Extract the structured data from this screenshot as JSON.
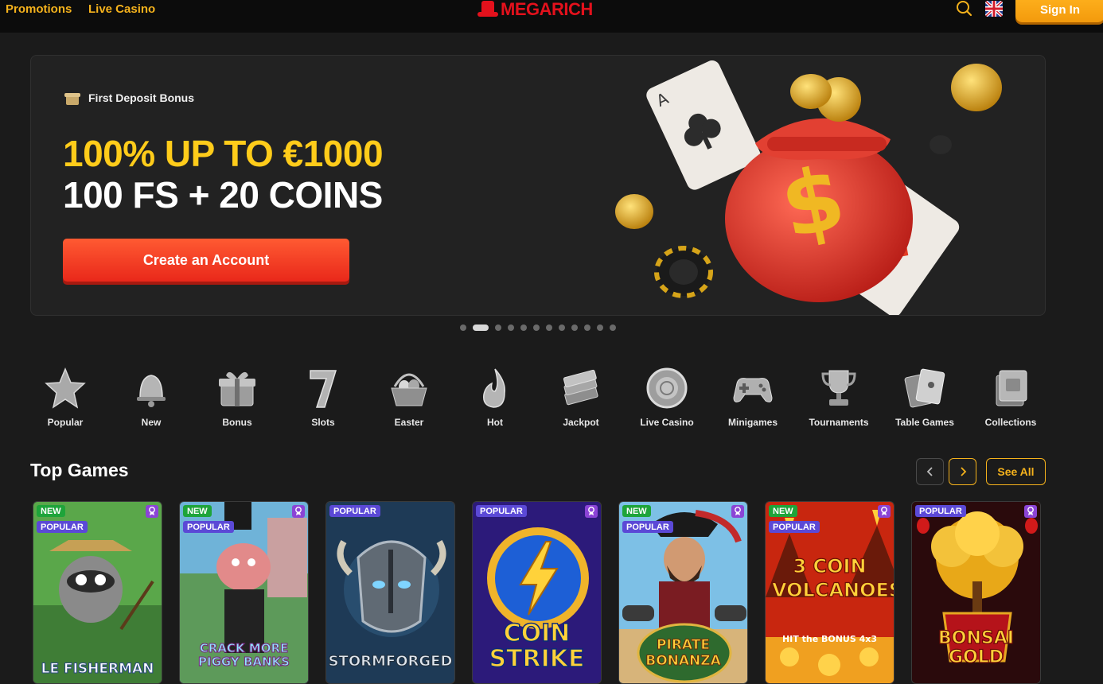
{
  "header": {
    "nav": [
      "Promotions",
      "Live Casino"
    ],
    "logo": "MEGARICH",
    "signin_label": "Sign In",
    "language": "English"
  },
  "hero": {
    "tag": "First Deposit Bonus",
    "headline_line1": "100% UP TO €1000",
    "headline_line2": "100 FS + 20 COINS",
    "cta_label": "Create an Account",
    "slides_total": 12,
    "active_slide": 2
  },
  "categories": [
    {
      "label": "Popular",
      "icon": "star-icon"
    },
    {
      "label": "New",
      "icon": "bell-icon"
    },
    {
      "label": "Bonus",
      "icon": "gift-icon"
    },
    {
      "label": "Slots",
      "icon": "seven-icon"
    },
    {
      "label": "Easter",
      "icon": "basket-icon"
    },
    {
      "label": "Hot",
      "icon": "flame-icon"
    },
    {
      "label": "Jackpot",
      "icon": "cash-stack-icon"
    },
    {
      "label": "Live Casino",
      "icon": "chip-icon"
    },
    {
      "label": "Minigames",
      "icon": "gamepad-icon"
    },
    {
      "label": "Tournaments",
      "icon": "trophy-icon"
    },
    {
      "label": "Table Games",
      "icon": "cards-icon"
    },
    {
      "label": "Collections",
      "icon": "collection-icon"
    }
  ],
  "top_games": {
    "title": "Top Games",
    "see_all_label": "See All",
    "games": [
      {
        "title": "LE FISHERMAN",
        "badges": [
          "NEW",
          "POPULAR"
        ]
      },
      {
        "title": "CRACK MORE PIGGY BANKS",
        "badges": [
          "NEW",
          "POPULAR"
        ]
      },
      {
        "title": "STORMFORGED",
        "badges": [
          "POPULAR"
        ]
      },
      {
        "title": "COIN STRIKE",
        "badges": [
          "POPULAR"
        ]
      },
      {
        "title": "PIRATE BONANZA",
        "badges": [
          "NEW",
          "POPULAR"
        ]
      },
      {
        "title": "3 COIN VOLCANOES",
        "subtitle": "HIT the BONUS 4x3",
        "badges": [
          "NEW",
          "POPULAR"
        ]
      },
      {
        "title": "BONSAI GOLD",
        "badges": [
          "POPULAR"
        ]
      }
    ]
  },
  "colors": {
    "accent": "#f5b21c",
    "brand_red": "#e3111c",
    "headline_yellow": "#ffcc1a",
    "cta_red": "#e9281a",
    "badge_new": "#1ea43a",
    "badge_popular": "#5b49d6"
  }
}
